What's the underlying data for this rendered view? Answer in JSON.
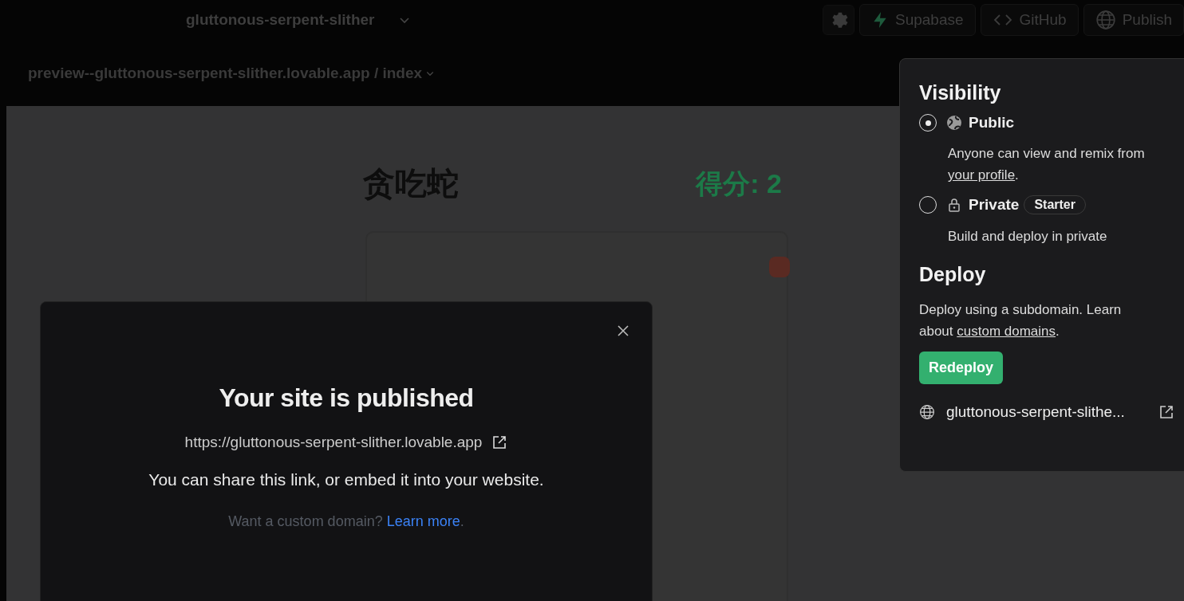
{
  "topbar": {
    "project": "gluttonous-serpent-slither",
    "buttons": [
      {
        "label": "Supabase",
        "kind": "supabase"
      },
      {
        "label": "GitHub",
        "kind": "github"
      },
      {
        "label": "Publish",
        "kind": "publish"
      }
    ]
  },
  "breadcrumb": {
    "path": "preview--gluttonous-serpent-slither.lovable.app / index"
  },
  "game": {
    "title": "贪吃蛇",
    "score": "得分: 2"
  },
  "modal": {
    "title": "Your site is published",
    "url": "https://gluttonous-serpent-slither.lovable.app",
    "note": "You can share this link, or embed it into your website.",
    "hint": "Want a custom domain?",
    "link": "Learn more",
    "after": "."
  },
  "popover": {
    "visibility_title": "Visibility",
    "options": [
      {
        "label": "Public",
        "kind": "public",
        "selected": true,
        "description": "Anyone can view and remix from",
        "link": "your profile",
        "after": "."
      },
      {
        "label": "Private",
        "kind": "private",
        "selected": false,
        "badge": "Starter",
        "description": "Build and deploy in private"
      }
    ],
    "deploy_title": "Deploy",
    "deploy_text": "Deploy using a subdomain. Learn about",
    "deploy_link": "custom domains",
    "deploy_after": ".",
    "button": "Redeploy",
    "domain": "gluttonous-serpent-slithe..."
  }
}
